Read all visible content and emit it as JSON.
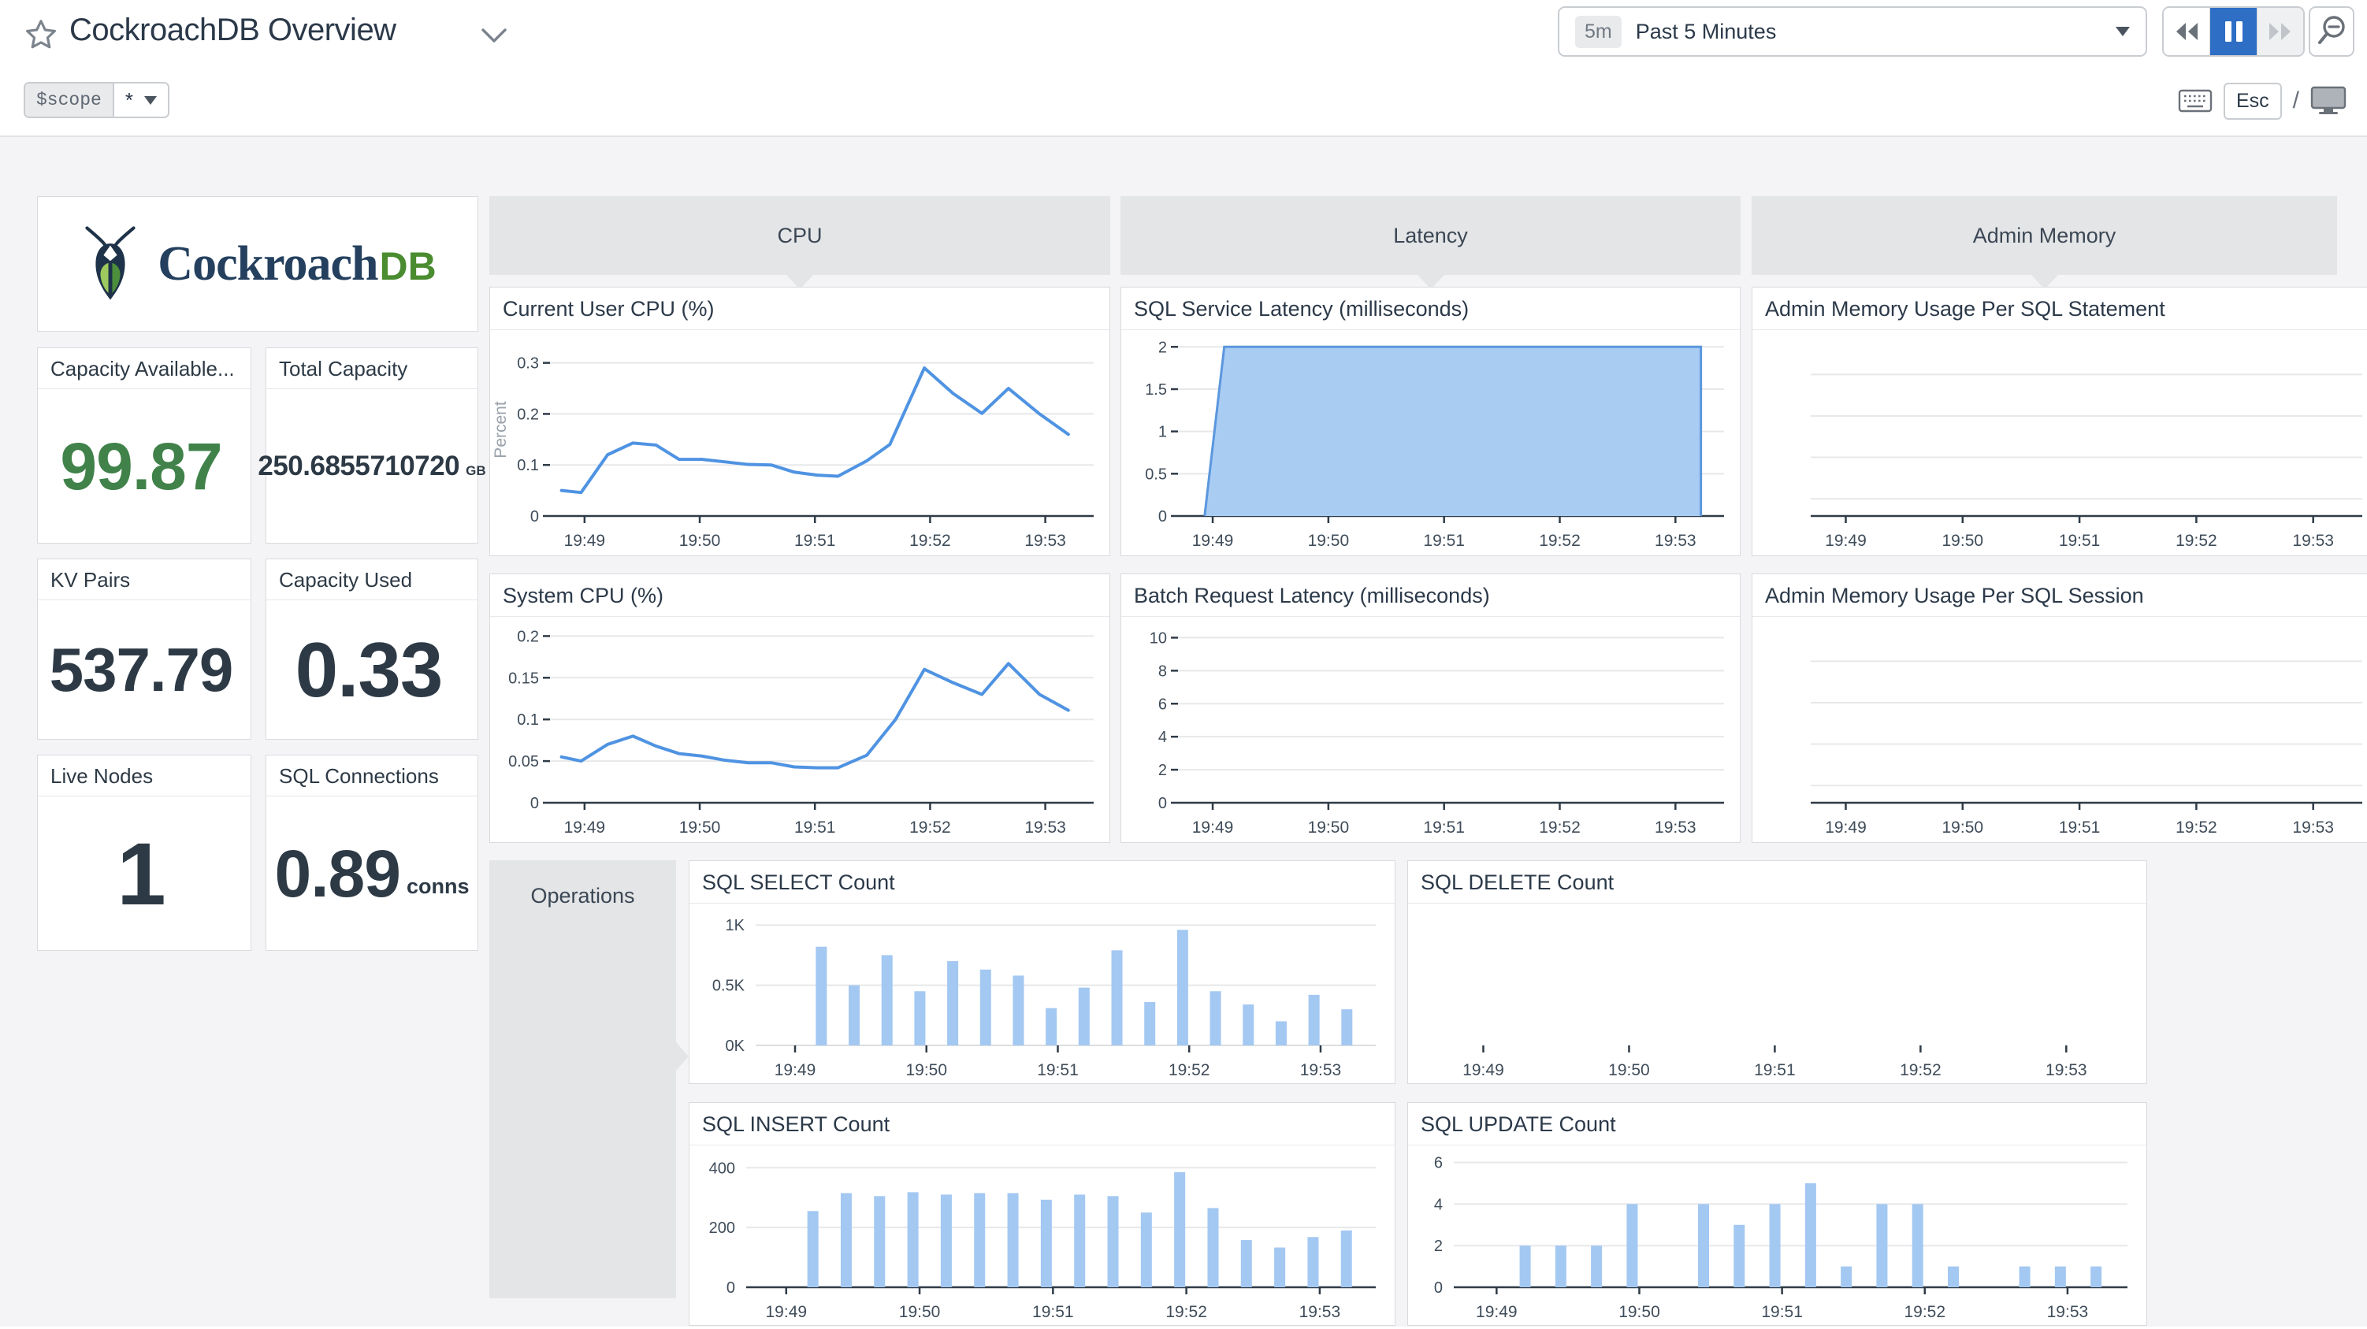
{
  "header": {
    "title": "CockroachDB Overview",
    "time_badge": "5m",
    "time_label": "Past 5 Minutes",
    "esc_label": "Esc",
    "slash": "/"
  },
  "scope": {
    "name": "$scope",
    "value": "*"
  },
  "logo": {
    "brand": "Cockroach",
    "brand_suffix": "DB"
  },
  "stats": [
    {
      "label": "Capacity Available...",
      "value": "99.87",
      "suffix": "",
      "color": "#40824a"
    },
    {
      "label": "Total Capacity",
      "value": "250.6855710720",
      "suffix": "GB",
      "color": "#2d3a46"
    },
    {
      "label": "KV Pairs",
      "value": "537.79",
      "suffix": "",
      "color": "#2d3a46"
    },
    {
      "label": "Capacity Used",
      "value": "0.33",
      "suffix": "",
      "color": "#2d3a46"
    },
    {
      "label": "Live Nodes",
      "value": "1",
      "suffix": "",
      "color": "#2d3a46"
    },
    {
      "label": "SQL Connections",
      "value": "0.89",
      "suffix": "conns",
      "color": "#2d3a46"
    }
  ],
  "groups": {
    "cpu": "CPU",
    "latency": "Latency",
    "admin_memory": "Admin Memory",
    "operations": "Operations"
  },
  "colors": {
    "line": "#4f93e2",
    "bar": "#a3c8f2",
    "area_fill": "#a9ccf3",
    "area_stroke": "#5b97dd",
    "grid": "#e7e8ea",
    "axis": "#2f3b47",
    "tick_text": "#3f4c59",
    "ylabel_text": "#9aa2ab",
    "pause_active": "#2e6ec5",
    "stat_green": "#40824a"
  },
  "chart_data": [
    {
      "title": "Current User CPU (%)",
      "type": "line",
      "ylabel": "Percent",
      "x_domain": [
        48.7,
        53.42
      ],
      "ymax": 0.338,
      "axis_line": true,
      "ydash": true,
      "xticks": [
        {
          "v": 49,
          "label": "19:49"
        },
        {
          "v": 50,
          "label": "19:50"
        },
        {
          "v": 51,
          "label": "19:51"
        },
        {
          "v": 52,
          "label": "19:52"
        },
        {
          "v": 53,
          "label": "19:53"
        }
      ],
      "yticks": [
        {
          "v": 0,
          "label": "0"
        },
        {
          "v": 0.1,
          "label": "0.1"
        },
        {
          "v": 0.2,
          "label": "0.2"
        },
        {
          "v": 0.3,
          "label": "0.3"
        }
      ],
      "points": [
        [
          48.8,
          0.05
        ],
        [
          48.97,
          0.046
        ],
        [
          49.2,
          0.12
        ],
        [
          49.42,
          0.143
        ],
        [
          49.62,
          0.139
        ],
        [
          49.82,
          0.111
        ],
        [
          50.02,
          0.111
        ],
        [
          50.22,
          0.106
        ],
        [
          50.42,
          0.101
        ],
        [
          50.62,
          0.1
        ],
        [
          50.82,
          0.086
        ],
        [
          51.02,
          0.08
        ],
        [
          51.2,
          0.078
        ],
        [
          51.45,
          0.108
        ],
        [
          51.65,
          0.14
        ],
        [
          51.95,
          0.29
        ],
        [
          52.2,
          0.24
        ],
        [
          52.45,
          0.201
        ],
        [
          52.68,
          0.25
        ],
        [
          52.95,
          0.2
        ],
        [
          53.2,
          0.16
        ]
      ],
      "margin": {
        "l": 76,
        "r": 20,
        "t": 16,
        "b": 50
      }
    },
    {
      "title": "System CPU (%)",
      "type": "line",
      "x_domain": [
        48.7,
        53.42
      ],
      "ymax": 0.207,
      "axis_line": true,
      "ydash": true,
      "xticks": [
        {
          "v": 49,
          "label": "19:49"
        },
        {
          "v": 50,
          "label": "19:50"
        },
        {
          "v": 51,
          "label": "19:51"
        },
        {
          "v": 52,
          "label": "19:52"
        },
        {
          "v": 53,
          "label": "19:53"
        }
      ],
      "yticks": [
        {
          "v": 0,
          "label": "0"
        },
        {
          "v": 0.05,
          "label": "0.05"
        },
        {
          "v": 0.1,
          "label": "0.1"
        },
        {
          "v": 0.15,
          "label": "0.15"
        },
        {
          "v": 0.2,
          "label": "0.2"
        }
      ],
      "points": [
        [
          48.8,
          0.055
        ],
        [
          48.97,
          0.05
        ],
        [
          49.2,
          0.07
        ],
        [
          49.42,
          0.08
        ],
        [
          49.62,
          0.068
        ],
        [
          49.82,
          0.059
        ],
        [
          50.02,
          0.056
        ],
        [
          50.22,
          0.051
        ],
        [
          50.42,
          0.048
        ],
        [
          50.62,
          0.048
        ],
        [
          50.82,
          0.043
        ],
        [
          51.02,
          0.042
        ],
        [
          51.2,
          0.042
        ],
        [
          51.45,
          0.057
        ],
        [
          51.7,
          0.1
        ],
        [
          51.95,
          0.16
        ],
        [
          52.2,
          0.144
        ],
        [
          52.45,
          0.13
        ],
        [
          52.68,
          0.167
        ],
        [
          52.95,
          0.13
        ],
        [
          53.2,
          0.111
        ]
      ],
      "margin": {
        "l": 76,
        "r": 20,
        "t": 16,
        "b": 50
      }
    },
    {
      "title": "SQL Service Latency (milliseconds)",
      "type": "area",
      "x_domain": [
        48.7,
        53.42
      ],
      "ymax": 2.04,
      "axis_line": true,
      "ydash": true,
      "xticks": [
        {
          "v": 49,
          "label": "19:49"
        },
        {
          "v": 50,
          "label": "19:50"
        },
        {
          "v": 51,
          "label": "19:51"
        },
        {
          "v": 52,
          "label": "19:52"
        },
        {
          "v": 53,
          "label": "19:53"
        }
      ],
      "yticks": [
        {
          "v": 0,
          "label": "0"
        },
        {
          "v": 0.5,
          "label": "0.5"
        },
        {
          "v": 1,
          "label": "1"
        },
        {
          "v": 1.5,
          "label": "1.5"
        },
        {
          "v": 2,
          "label": "2"
        }
      ],
      "points": [
        [
          48.93,
          0
        ],
        [
          49.1,
          2
        ],
        [
          53.22,
          2
        ],
        [
          53.22,
          0
        ]
      ],
      "margin": {
        "l": 72,
        "r": 20,
        "t": 16,
        "b": 50
      }
    },
    {
      "title": "Batch Request Latency (milliseconds)",
      "type": "empty",
      "x_domain": [
        48.7,
        53.42
      ],
      "ymax": 10.45,
      "axis_line": true,
      "ydash": true,
      "xticks": [
        {
          "v": 49,
          "label": "19:49"
        },
        {
          "v": 50,
          "label": "19:50"
        },
        {
          "v": 51,
          "label": "19:51"
        },
        {
          "v": 52,
          "label": "19:52"
        },
        {
          "v": 53,
          "label": "19:53"
        }
      ],
      "yticks": [
        {
          "v": 0,
          "label": "0"
        },
        {
          "v": 2,
          "label": "2"
        },
        {
          "v": 4,
          "label": "4"
        },
        {
          "v": 6,
          "label": "6"
        },
        {
          "v": 8,
          "label": "8"
        },
        {
          "v": 10,
          "label": "10"
        }
      ],
      "margin": {
        "l": 72,
        "r": 20,
        "t": 16,
        "b": 50
      }
    },
    {
      "title": "Admin Memory Usage Per SQL Statement",
      "type": "empty",
      "x_domain": [
        48.7,
        53.42
      ],
      "ymax": 1,
      "axis_line": true,
      "ydash": false,
      "grid_fractions": [
        0.18,
        0.42,
        0.66,
        0.9
      ],
      "xticks": [
        {
          "v": 49,
          "label": "19:49"
        },
        {
          "v": 50,
          "label": "19:50"
        },
        {
          "v": 51,
          "label": "19:51"
        },
        {
          "v": 52,
          "label": "19:52"
        },
        {
          "v": 53,
          "label": "19:53"
        }
      ],
      "margin": {
        "l": 74,
        "r": 6,
        "t": 16,
        "b": 50
      }
    },
    {
      "title": "Admin Memory Usage Per SQL Session",
      "type": "empty",
      "x_domain": [
        48.7,
        53.42
      ],
      "ymax": 1,
      "axis_line": true,
      "ydash": false,
      "grid_fractions": [
        0.18,
        0.42,
        0.66,
        0.9
      ],
      "xticks": [
        {
          "v": 49,
          "label": "19:49"
        },
        {
          "v": 50,
          "label": "19:50"
        },
        {
          "v": 51,
          "label": "19:51"
        },
        {
          "v": 52,
          "label": "19:52"
        },
        {
          "v": 53,
          "label": "19:53"
        }
      ],
      "margin": {
        "l": 74,
        "r": 6,
        "t": 16,
        "b": 50
      }
    },
    {
      "title": "SQL SELECT Count",
      "type": "bar",
      "x_domain": [
        48.7,
        53.42
      ],
      "ymax": 1080,
      "axis_line": false,
      "ydash": false,
      "zero_grid": true,
      "xticks": [
        {
          "v": 49,
          "label": "19:49"
        },
        {
          "v": 50,
          "label": "19:50"
        },
        {
          "v": 51,
          "label": "19:51"
        },
        {
          "v": 52,
          "label": "19:52"
        },
        {
          "v": 53,
          "label": "19:53"
        }
      ],
      "yticks": [
        {
          "v": 0,
          "label": "0K"
        },
        {
          "v": 500,
          "label": "0.5K"
        },
        {
          "v": 1000,
          "label": "1K"
        }
      ],
      "bars": [
        [
          49.2,
          820
        ],
        [
          49.45,
          500
        ],
        [
          49.7,
          750
        ],
        [
          49.95,
          450
        ],
        [
          50.2,
          700
        ],
        [
          50.45,
          630
        ],
        [
          50.7,
          580
        ],
        [
          50.95,
          310
        ],
        [
          51.2,
          480
        ],
        [
          51.45,
          790
        ],
        [
          51.7,
          360
        ],
        [
          51.95,
          960
        ],
        [
          52.2,
          450
        ],
        [
          52.45,
          340
        ],
        [
          52.7,
          200
        ],
        [
          52.95,
          420
        ],
        [
          53.2,
          300
        ]
      ],
      "margin": {
        "l": 84,
        "r": 24,
        "t": 14,
        "b": 48
      }
    },
    {
      "title": "SQL DELETE Count",
      "type": "empty",
      "x_domain": [
        48.7,
        53.42
      ],
      "ymax": 1,
      "axis_line": false,
      "ydash": false,
      "xticks": [
        {
          "v": 49,
          "label": "19:49"
        },
        {
          "v": 50,
          "label": "19:50"
        },
        {
          "v": 51,
          "label": "19:51"
        },
        {
          "v": 52,
          "label": "19:52"
        },
        {
          "v": 53,
          "label": "19:53"
        }
      ],
      "margin": {
        "l": 40,
        "r": 24,
        "t": 14,
        "b": 48
      }
    },
    {
      "title": "SQL INSERT Count",
      "type": "bar",
      "x_domain": [
        48.7,
        53.42
      ],
      "ymax": 435,
      "axis_line": true,
      "ydash": false,
      "xticks": [
        {
          "v": 49,
          "label": "19:49"
        },
        {
          "v": 50,
          "label": "19:50"
        },
        {
          "v": 51,
          "label": "19:51"
        },
        {
          "v": 52,
          "label": "19:52"
        },
        {
          "v": 53,
          "label": "19:53"
        }
      ],
      "yticks": [
        {
          "v": 0,
          "label": "0"
        },
        {
          "v": 200,
          "label": "200"
        },
        {
          "v": 400,
          "label": "400"
        }
      ],
      "bars": [
        [
          49.2,
          255
        ],
        [
          49.45,
          315
        ],
        [
          49.7,
          305
        ],
        [
          49.95,
          318
        ],
        [
          50.2,
          310
        ],
        [
          50.45,
          315
        ],
        [
          50.7,
          315
        ],
        [
          50.95,
          293
        ],
        [
          51.2,
          310
        ],
        [
          51.45,
          305
        ],
        [
          51.7,
          250
        ],
        [
          51.95,
          385
        ],
        [
          52.2,
          265
        ],
        [
          52.45,
          158
        ],
        [
          52.7,
          133
        ],
        [
          52.95,
          168
        ],
        [
          53.2,
          190
        ]
      ],
      "margin": {
        "l": 72,
        "r": 24,
        "t": 14,
        "b": 48
      }
    },
    {
      "title": "SQL UPDATE Count",
      "type": "bar",
      "x_domain": [
        48.7,
        53.42
      ],
      "ymax": 6.25,
      "axis_line": true,
      "ydash": false,
      "xticks": [
        {
          "v": 49,
          "label": "19:49"
        },
        {
          "v": 50,
          "label": "19:50"
        },
        {
          "v": 51,
          "label": "19:51"
        },
        {
          "v": 52,
          "label": "19:52"
        },
        {
          "v": 53,
          "label": "19:53"
        }
      ],
      "yticks": [
        {
          "v": 0,
          "label": "0"
        },
        {
          "v": 2,
          "label": "2"
        },
        {
          "v": 4,
          "label": "4"
        },
        {
          "v": 6,
          "label": "6"
        }
      ],
      "bars": [
        [
          49.2,
          2
        ],
        [
          49.45,
          2
        ],
        [
          49.7,
          2
        ],
        [
          49.95,
          4
        ],
        [
          50.45,
          4
        ],
        [
          50.7,
          3
        ],
        [
          50.95,
          4
        ],
        [
          51.2,
          5
        ],
        [
          51.45,
          1
        ],
        [
          51.7,
          4
        ],
        [
          51.95,
          4
        ],
        [
          52.2,
          1
        ],
        [
          52.7,
          1
        ],
        [
          52.95,
          1
        ],
        [
          53.2,
          1
        ]
      ],
      "margin": {
        "l": 58,
        "r": 24,
        "t": 14,
        "b": 48
      }
    }
  ]
}
